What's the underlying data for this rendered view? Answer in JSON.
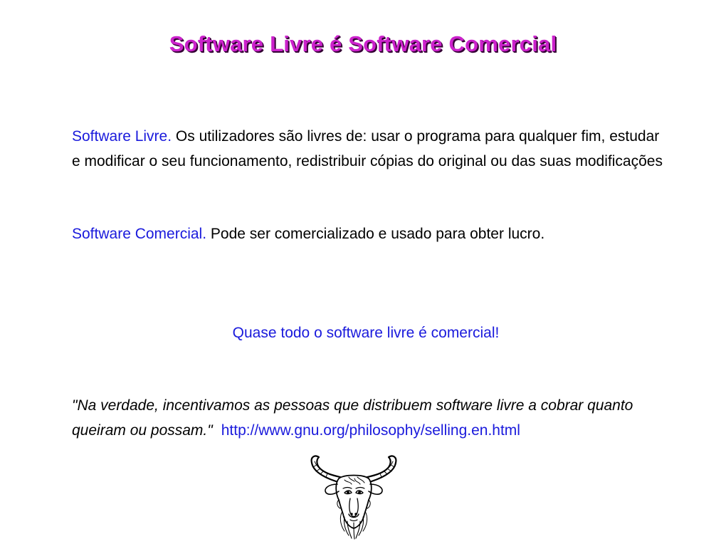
{
  "title": "Software Livre é Software Comercial",
  "free_software": {
    "term": "Software Livre.",
    "definition": "Os utilizadores são livres de: usar o programa para qualquer fim, estudar e modificar o seu funcionamento, redistribuir cópias do original ou das suas modificações"
  },
  "commercial_software": {
    "term": "Software Comercial.",
    "definition": "Pode ser comercializado e usado para obter lucro."
  },
  "tagline": "Quase todo o software livre é comercial!",
  "quote": {
    "text": "\"Na verdade, incentivamos as pessoas que distribuem software livre a cobrar quanto queiram ou possam.\"",
    "link_text": "http://www.gnu.org/philosophy/selling.en.html"
  },
  "logo": {
    "icon": "gnu-head-icon"
  },
  "colors": {
    "title": "#cc22cc",
    "title_shadow": "#330033",
    "accent": "#1a1adc",
    "text": "#000000",
    "background": "#ffffff"
  }
}
